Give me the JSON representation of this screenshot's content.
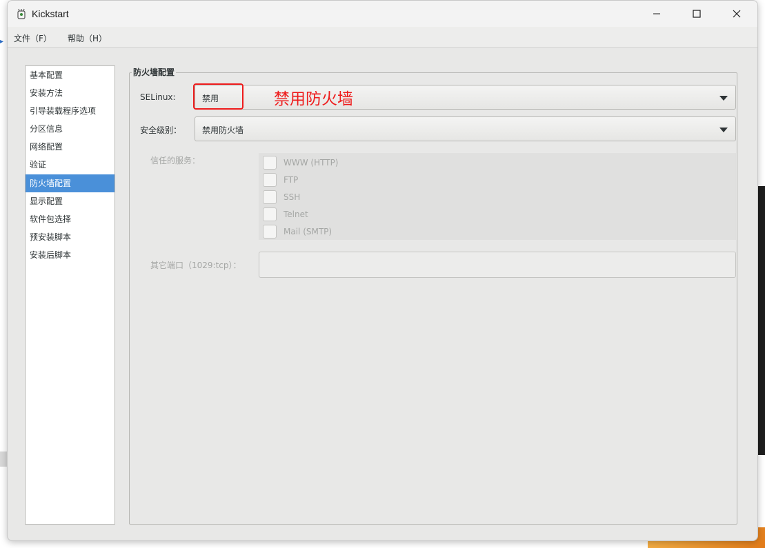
{
  "window": {
    "title": "Kickstart",
    "controls": {
      "minimize": "minimize-icon",
      "maximize": "maximize-icon",
      "close": "close-icon"
    }
  },
  "menu": [
    {
      "label": "文件（F）"
    },
    {
      "label": "帮助（H）"
    }
  ],
  "sidebar": {
    "items": [
      {
        "label": "基本配置"
      },
      {
        "label": "安装方法"
      },
      {
        "label": "引导装载程序选项"
      },
      {
        "label": "分区信息"
      },
      {
        "label": "网络配置"
      },
      {
        "label": "验证"
      },
      {
        "label": "防火墙配置",
        "selected": true
      },
      {
        "label": "显示配置"
      },
      {
        "label": "软件包选择"
      },
      {
        "label": "预安装脚本"
      },
      {
        "label": "安装后脚本"
      }
    ]
  },
  "firewall": {
    "section_title": "防火墙配置",
    "selinux_label": "SELinux:",
    "selinux_value": "禁用",
    "security_label": "安全级别：",
    "security_value": "禁用防火墙",
    "trusted_label": "信任的服务：",
    "services": [
      {
        "label": "WWW (HTTP)",
        "checked": false
      },
      {
        "label": "FTP",
        "checked": false
      },
      {
        "label": "SSH",
        "checked": false
      },
      {
        "label": "Telnet",
        "checked": false
      },
      {
        "label": "Mail (SMTP)",
        "checked": false
      }
    ],
    "other_ports_label": "其它端口（1029:tcp）：",
    "other_ports_value": ""
  },
  "annotation": {
    "text": "禁用防火墙",
    "color": "#ee1b1b"
  },
  "colors": {
    "selection": "#4a90d9",
    "window_bg": "#e8e8e7"
  }
}
